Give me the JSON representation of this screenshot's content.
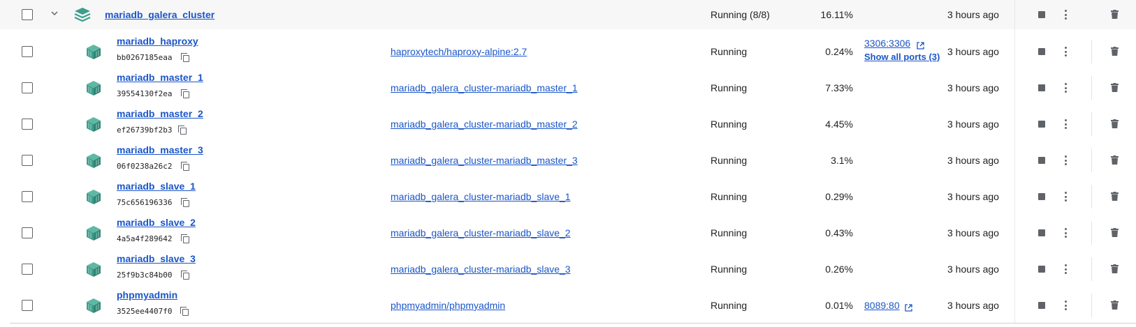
{
  "group": {
    "name": "mariadb_galera_cluster",
    "status": "Running (8/8)",
    "cpu": "16.11%",
    "started": "3 hours ago"
  },
  "containers": [
    {
      "name": "mariadb_haproxy",
      "id": "bb0267185eaa",
      "image": "haproxytech/haproxy-alpine:2.7",
      "status": "Running",
      "cpu": "0.24%",
      "port": "3306:3306",
      "all_ports": "Show all ports (3)",
      "started": "3 hours ago"
    },
    {
      "name": "mariadb_master_1",
      "id": "39554130f2ea",
      "image": "mariadb_galera_cluster-mariadb_master_1",
      "status": "Running",
      "cpu": "7.33%",
      "port": "",
      "all_ports": "",
      "started": "3 hours ago"
    },
    {
      "name": "mariadb_master_2",
      "id": "ef26739bf2b3",
      "image": "mariadb_galera_cluster-mariadb_master_2",
      "status": "Running",
      "cpu": "4.45%",
      "port": "",
      "all_ports": "",
      "started": "3 hours ago"
    },
    {
      "name": "mariadb_master_3",
      "id": "06f0238a26c2",
      "image": "mariadb_galera_cluster-mariadb_master_3",
      "status": "Running",
      "cpu": "3.1%",
      "port": "",
      "all_ports": "",
      "started": "3 hours ago"
    },
    {
      "name": "mariadb_slave_1",
      "id": "75c656196336",
      "image": "mariadb_galera_cluster-mariadb_slave_1",
      "status": "Running",
      "cpu": "0.29%",
      "port": "",
      "all_ports": "",
      "started": "3 hours ago"
    },
    {
      "name": "mariadb_slave_2",
      "id": "4a5a4f289642",
      "image": "mariadb_galera_cluster-mariadb_slave_2",
      "status": "Running",
      "cpu": "0.43%",
      "port": "",
      "all_ports": "",
      "started": "3 hours ago"
    },
    {
      "name": "mariadb_slave_3",
      "id": "25f9b3c84b00",
      "image": "mariadb_galera_cluster-mariadb_slave_3",
      "status": "Running",
      "cpu": "0.26%",
      "port": "",
      "all_ports": "",
      "started": "3 hours ago"
    },
    {
      "name": "phpmyadmin",
      "id": "3525ee4407f0",
      "image": "phpmyadmin/phpmyadmin",
      "status": "Running",
      "cpu": "0.01%",
      "port": "8089:80",
      "all_ports": "",
      "started": "3 hours ago"
    }
  ],
  "colors": {
    "link": "#1a56c8",
    "icon_teal": "#3d9e8c",
    "icon_grey": "#5f6368"
  },
  "icons": {
    "group": "stack-icon",
    "container": "cube-icon",
    "copy": "copy-icon",
    "external": "external-link-icon",
    "stop": "stop-icon",
    "more": "more-icon",
    "delete": "trash-icon",
    "expand": "chevron-down-icon"
  }
}
